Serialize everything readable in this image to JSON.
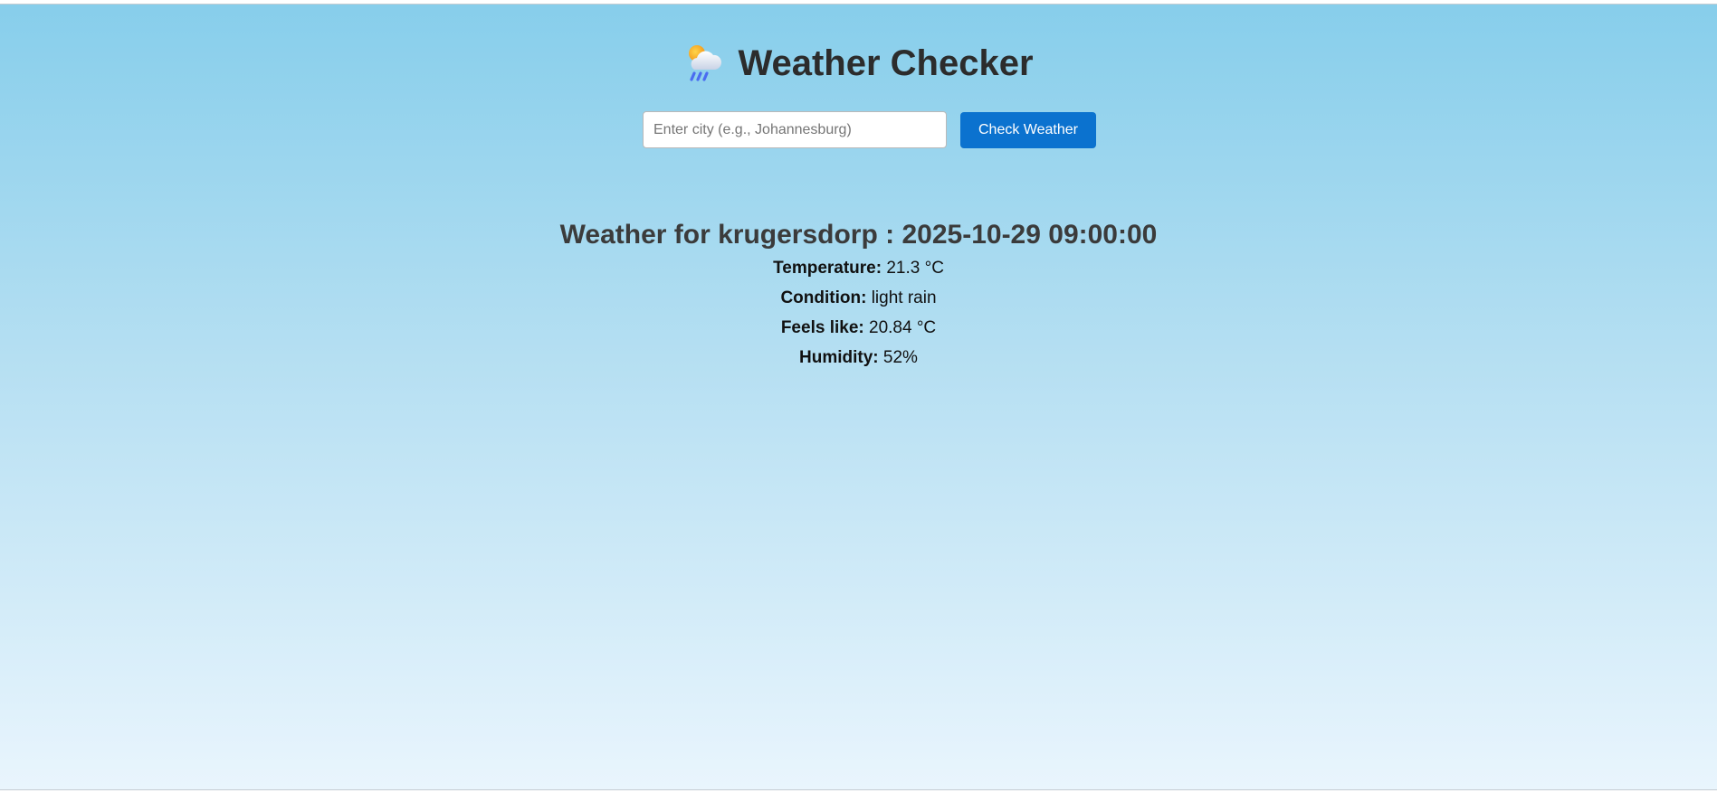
{
  "app": {
    "title": "Weather Checker",
    "icon": "sun-behind-rain-cloud-icon"
  },
  "search": {
    "placeholder": "Enter city (e.g., Johannesburg)",
    "value": "",
    "button_label": "Check Weather"
  },
  "result": {
    "heading": "Weather for krugersdorp : 2025-10-29 09:00:00",
    "rows": [
      {
        "label": "Temperature:",
        "value": "21.3 °C"
      },
      {
        "label": "Condition:",
        "value": "light rain"
      },
      {
        "label": "Feels like:",
        "value": "20.84 °C"
      },
      {
        "label": "Humidity:",
        "value": "52%"
      }
    ]
  },
  "colors": {
    "button_bg": "#0b72cf",
    "title_text": "#2c2c2c",
    "gradient_top": "#87ceeb",
    "gradient_bottom": "#e9f5fd"
  }
}
